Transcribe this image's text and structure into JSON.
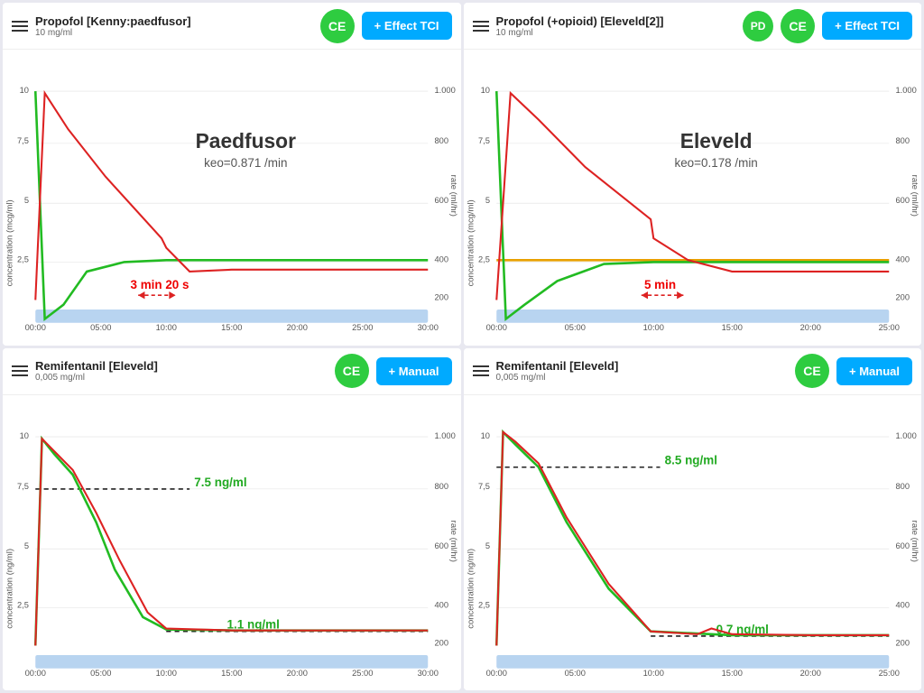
{
  "panels": [
    {
      "id": "top-left",
      "header": {
        "drug_name": "Propofol [Kenny:paedfusor]",
        "drug_sub": "10 mg/ml",
        "ce_label": "CE",
        "btn_label": "+ Effect TCI",
        "has_pd": false
      },
      "chart": {
        "title": "Paedfusor",
        "subtitle": "keo=0.871 /min",
        "y_left_label": "concentration (mcg/ml)",
        "y_right_label": "rate (ml/hr)",
        "annotation": "3 min 20 s",
        "x_ticks": [
          "00:00",
          "05:00",
          "10:00",
          "15:00",
          "20:00",
          "25:00",
          "30:00"
        ],
        "y_left_ticks": [
          "10",
          "7,5",
          "5",
          "2,5"
        ],
        "y_right_ticks": [
          "1.000",
          "800",
          "600",
          "400",
          "200"
        ]
      }
    },
    {
      "id": "top-right",
      "header": {
        "drug_name": "Propofol (+opioid) [Eleveld[2]]",
        "drug_sub": "10 mg/ml",
        "ce_label": "CE",
        "pd_label": "PD",
        "btn_label": "+ Effect TCI",
        "has_pd": true
      },
      "chart": {
        "title": "Eleveld",
        "subtitle": "keo=0.178 /min",
        "y_left_label": "concentration (mcg/ml)",
        "y_right_label": "rate (ml/hr)",
        "annotation": "5 min",
        "x_ticks": [
          "00:00",
          "05:00",
          "10:00",
          "15:00",
          "20:00",
          "25:00"
        ],
        "y_left_ticks": [
          "10",
          "7,5",
          "5",
          "2,5"
        ],
        "y_right_ticks": [
          "1.000",
          "800",
          "600",
          "400",
          "200"
        ]
      }
    },
    {
      "id": "bottom-left",
      "header": {
        "drug_name": "Remifentanil [Eleveld]",
        "drug_sub": "0,005 mg/ml",
        "ce_label": "CE",
        "btn_label": "+ Manual",
        "has_pd": false
      },
      "chart": {
        "title": "",
        "subtitle": "",
        "y_left_label": "concentration (ng/ml)",
        "y_right_label": "rate (ml/hr)",
        "annotation_top": "7.5 ng/ml",
        "annotation_bottom": "1.1 ng/ml",
        "x_ticks": [
          "00:00",
          "05:00",
          "10:00",
          "15:00",
          "20:00",
          "25:00",
          "30:00"
        ],
        "y_left_ticks": [
          "10",
          "7,5",
          "5",
          "2,5"
        ],
        "y_right_ticks": [
          "1.000",
          "800",
          "600",
          "400",
          "200"
        ]
      }
    },
    {
      "id": "bottom-right",
      "header": {
        "drug_name": "Remifentanil [Eleveld]",
        "drug_sub": "0,005 mg/ml",
        "ce_label": "CE",
        "btn_label": "+ Manual",
        "has_pd": false
      },
      "chart": {
        "title": "",
        "subtitle": "",
        "y_left_label": "concentration (ng/ml)",
        "y_right_label": "rate (ml/hr)",
        "annotation_top": "8.5 ng/ml",
        "annotation_bottom": "0.7 ng/ml",
        "x_ticks": [
          "00:00",
          "05:00",
          "10:00",
          "15:00",
          "20:00",
          "25:00"
        ],
        "y_left_ticks": [
          "10",
          "7,5",
          "5",
          "2,5"
        ],
        "y_right_ticks": [
          "1.000",
          "800",
          "600",
          "400",
          "200"
        ]
      }
    }
  ]
}
